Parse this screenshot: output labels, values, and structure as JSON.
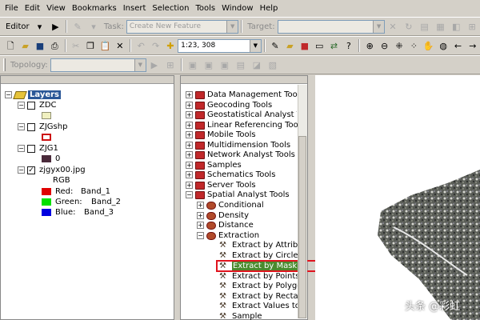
{
  "menu": [
    "File",
    "Edit",
    "View",
    "Bookmarks",
    "Insert",
    "Selection",
    "Tools",
    "Window",
    "Help"
  ],
  "editor_toolbar": {
    "editor_label": "Editor",
    "task_label": "Task:",
    "task_value": "Create New Feature",
    "target_label": "Target:",
    "target_value": ""
  },
  "standard_toolbar": {
    "scale_value": "1:23, 308"
  },
  "topology_toolbar": {
    "label": "Topology:",
    "value": ""
  },
  "toc": {
    "root_label": "Layers",
    "layers": [
      {
        "name": "ZDC",
        "checked": false,
        "legend_color": "#f0f0c0",
        "legend_border": "#909070"
      },
      {
        "name": "ZJGshp",
        "checked": false,
        "legend_color": "#ffffff",
        "legend_border": "#cc1111"
      },
      {
        "name": "ZJG1",
        "checked": false,
        "legend_color": "#4a2a3a",
        "legend_border": "#4a2a3a",
        "legend_text": "0"
      },
      {
        "name": "zjgyx00.jpg",
        "checked": true,
        "subtitle": "RGB",
        "bands": [
          {
            "label": "Red:",
            "band": "Band_1",
            "color": "#e00000"
          },
          {
            "label": "Green:",
            "band": "Band_2",
            "color": "#00e000"
          },
          {
            "label": "Blue:",
            "band": "Band_3",
            "color": "#0000e0"
          }
        ]
      }
    ]
  },
  "toolbox": {
    "toolsets": [
      "Data Management Tools",
      "Geocoding Tools",
      "Geostatistical Analyst Tools",
      "Linear Referencing Tools",
      "Mobile Tools",
      "Multidimension Tools",
      "Network Analyst Tools",
      "Samples",
      "Schematics Tools",
      "Server Tools",
      "Spatial Analyst Tools"
    ],
    "spatial_subsets": [
      "Conditional",
      "Density",
      "Distance",
      "Extraction"
    ],
    "extraction_tools": [
      "Extract by Attributes",
      "Extract by Circle",
      "Extract by Mask",
      "Extract by Points",
      "Extract by Polygon",
      "Extract by Rectangle",
      "Extract Values to Points",
      "Sample"
    ],
    "selected_tool_index": 2
  },
  "watermark": "头条 @彩虹",
  "colors": {
    "chrome": "#d4d0c8",
    "selection": "#2b5797",
    "highlight": "#4a8a2e",
    "annotation": "#e0141e"
  }
}
